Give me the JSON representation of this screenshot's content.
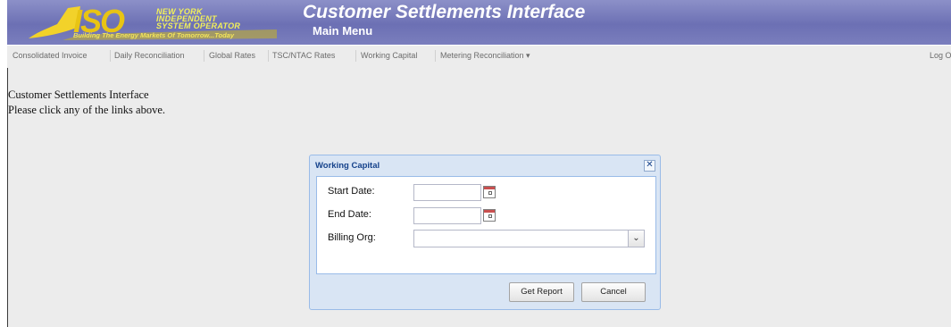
{
  "header": {
    "logo_lines": [
      "NEW YORK",
      "INDEPENDENT",
      "SYSTEM OPERATOR"
    ],
    "tagline": "Building The Energy Markets Of Tomorrow...Today",
    "title": "Customer Settlements Interface",
    "subtitle": "Main Menu"
  },
  "nav": {
    "items": [
      "Consolidated Invoice",
      "Daily Reconciliation",
      "Global Rates",
      "TSC/NTAC Rates",
      "Working Capital",
      "Metering Reconciliation ▾"
    ],
    "logout": "Log Ou"
  },
  "content": {
    "heading": "Customer Settlements Interface",
    "instruction": "Please click any of the links above."
  },
  "dialog": {
    "title": "Working Capital",
    "close_glyph": "✕",
    "start_label": "Start Date:",
    "end_label": "End Date:",
    "billing_label": "Billing Org:",
    "start_value": "",
    "end_value": "",
    "billing_value": "",
    "dropdown_glyph": "⌄",
    "get_report": "Get Report",
    "cancel": "Cancel"
  },
  "colors": {
    "header_bg": "#7a7ebd",
    "dialog_title": "#15428b",
    "dialog_frame": "#d9e5f4",
    "logo_yellow": "#f2d22a"
  },
  "icons": [
    "nyiso-logo",
    "calendar-icon",
    "chevron-down-icon",
    "close-icon"
  ]
}
